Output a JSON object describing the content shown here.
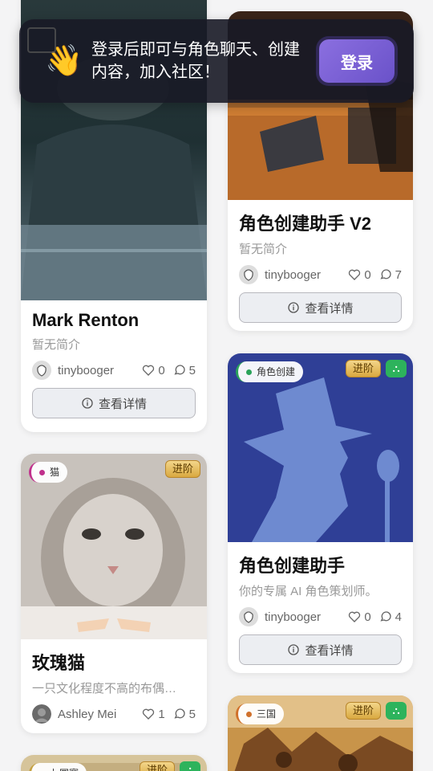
{
  "banner": {
    "hand_icon": "👋",
    "message": "登录后即可与角色聊天、创建内容，加入社区！",
    "login_label": "登录"
  },
  "common": {
    "detail_label": "查看详情",
    "advanced_badge": "进阶"
  },
  "cards": [
    {
      "title": "Mark Renton",
      "desc": "暂无简介",
      "author": "tinybooger",
      "likes": "0",
      "comments": "5"
    },
    {
      "title": "角色创建助手 V2",
      "desc": "暂无简介",
      "author": "tinybooger",
      "likes": "0",
      "comments": "7"
    },
    {
      "tag": "角色创建",
      "tag_color": "#2aa35a",
      "title": "角色创建助手",
      "desc": "你的专属 AI 角色策划师。",
      "author": "tinybooger",
      "likes": "0",
      "comments": "4"
    },
    {
      "tag": "猫",
      "tag_color": "#c0308c",
      "title": "玫瑰猫",
      "desc": "一只文化程度不高的布偶…",
      "author": "Ashley Mei",
      "likes": "1",
      "comments": "5"
    },
    {
      "tag": "三国",
      "tag_color": "#d0702a"
    },
    {
      "tag": "七国赛",
      "tag_color": "#c4a040"
    }
  ]
}
